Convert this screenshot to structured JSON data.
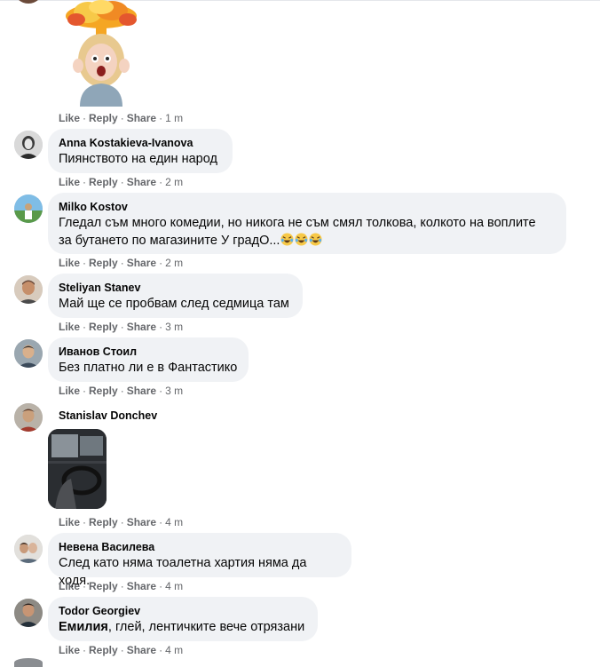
{
  "actions": {
    "like": "Like",
    "reply": "Reply",
    "share": "Share",
    "sep": "·"
  },
  "comments": [
    {
      "time": "1 m"
    },
    {
      "author": "Anna Kostakieva-Ivanova",
      "text": "Пиянството на един народ",
      "time": "2 m"
    },
    {
      "author": "Milko Kostov",
      "text_line1": "Гледал съм много комедии, но никога не съм смял толкова, колкото на воплите",
      "text_line2": "за бутането по магазините У градО...",
      "time": "2 m"
    },
    {
      "author": "Steliyan Stanev",
      "text": "Май ще се пробвам след седмица там",
      "time": "3 m"
    },
    {
      "author": "Иванов Стоил",
      "text": "Без платно ли е в Фантастико",
      "time": "3 m"
    },
    {
      "author": "Stanislav Donchev",
      "time": "4 m"
    },
    {
      "author": "Невена Василева",
      "text": "След като няма тоалетна хартия няма да ходя.",
      "time": "4 m"
    },
    {
      "author": "Todor Georgiev",
      "tag": "Емилия",
      "text": ", глей, лентичките вече отрязани",
      "time": "4 m"
    }
  ],
  "colors": {
    "bubble": "#f0f2f5",
    "meta": "#65676b",
    "text": "#050505"
  },
  "icons": [
    "laughing-emoji-icon",
    "exploding-head-sticker",
    "video-thumbnail"
  ]
}
